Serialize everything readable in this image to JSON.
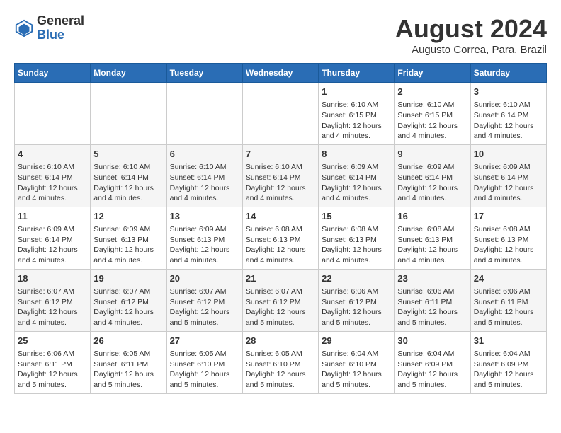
{
  "header": {
    "logo_line1": "General",
    "logo_line2": "Blue",
    "title": "August 2024",
    "subtitle": "Augusto Correa, Para, Brazil"
  },
  "weekdays": [
    "Sunday",
    "Monday",
    "Tuesday",
    "Wednesday",
    "Thursday",
    "Friday",
    "Saturday"
  ],
  "weeks": [
    [
      {
        "day": "",
        "content": ""
      },
      {
        "day": "",
        "content": ""
      },
      {
        "day": "",
        "content": ""
      },
      {
        "day": "",
        "content": ""
      },
      {
        "day": "1",
        "content": "Sunrise: 6:10 AM\nSunset: 6:15 PM\nDaylight: 12 hours\nand 4 minutes."
      },
      {
        "day": "2",
        "content": "Sunrise: 6:10 AM\nSunset: 6:15 PM\nDaylight: 12 hours\nand 4 minutes."
      },
      {
        "day": "3",
        "content": "Sunrise: 6:10 AM\nSunset: 6:14 PM\nDaylight: 12 hours\nand 4 minutes."
      }
    ],
    [
      {
        "day": "4",
        "content": "Sunrise: 6:10 AM\nSunset: 6:14 PM\nDaylight: 12 hours\nand 4 minutes."
      },
      {
        "day": "5",
        "content": "Sunrise: 6:10 AM\nSunset: 6:14 PM\nDaylight: 12 hours\nand 4 minutes."
      },
      {
        "day": "6",
        "content": "Sunrise: 6:10 AM\nSunset: 6:14 PM\nDaylight: 12 hours\nand 4 minutes."
      },
      {
        "day": "7",
        "content": "Sunrise: 6:10 AM\nSunset: 6:14 PM\nDaylight: 12 hours\nand 4 minutes."
      },
      {
        "day": "8",
        "content": "Sunrise: 6:09 AM\nSunset: 6:14 PM\nDaylight: 12 hours\nand 4 minutes."
      },
      {
        "day": "9",
        "content": "Sunrise: 6:09 AM\nSunset: 6:14 PM\nDaylight: 12 hours\nand 4 minutes."
      },
      {
        "day": "10",
        "content": "Sunrise: 6:09 AM\nSunset: 6:14 PM\nDaylight: 12 hours\nand 4 minutes."
      }
    ],
    [
      {
        "day": "11",
        "content": "Sunrise: 6:09 AM\nSunset: 6:14 PM\nDaylight: 12 hours\nand 4 minutes."
      },
      {
        "day": "12",
        "content": "Sunrise: 6:09 AM\nSunset: 6:13 PM\nDaylight: 12 hours\nand 4 minutes."
      },
      {
        "day": "13",
        "content": "Sunrise: 6:09 AM\nSunset: 6:13 PM\nDaylight: 12 hours\nand 4 minutes."
      },
      {
        "day": "14",
        "content": "Sunrise: 6:08 AM\nSunset: 6:13 PM\nDaylight: 12 hours\nand 4 minutes."
      },
      {
        "day": "15",
        "content": "Sunrise: 6:08 AM\nSunset: 6:13 PM\nDaylight: 12 hours\nand 4 minutes."
      },
      {
        "day": "16",
        "content": "Sunrise: 6:08 AM\nSunset: 6:13 PM\nDaylight: 12 hours\nand 4 minutes."
      },
      {
        "day": "17",
        "content": "Sunrise: 6:08 AM\nSunset: 6:13 PM\nDaylight: 12 hours\nand 4 minutes."
      }
    ],
    [
      {
        "day": "18",
        "content": "Sunrise: 6:07 AM\nSunset: 6:12 PM\nDaylight: 12 hours\nand 4 minutes."
      },
      {
        "day": "19",
        "content": "Sunrise: 6:07 AM\nSunset: 6:12 PM\nDaylight: 12 hours\nand 4 minutes."
      },
      {
        "day": "20",
        "content": "Sunrise: 6:07 AM\nSunset: 6:12 PM\nDaylight: 12 hours\nand 5 minutes."
      },
      {
        "day": "21",
        "content": "Sunrise: 6:07 AM\nSunset: 6:12 PM\nDaylight: 12 hours\nand 5 minutes."
      },
      {
        "day": "22",
        "content": "Sunrise: 6:06 AM\nSunset: 6:12 PM\nDaylight: 12 hours\nand 5 minutes."
      },
      {
        "day": "23",
        "content": "Sunrise: 6:06 AM\nSunset: 6:11 PM\nDaylight: 12 hours\nand 5 minutes."
      },
      {
        "day": "24",
        "content": "Sunrise: 6:06 AM\nSunset: 6:11 PM\nDaylight: 12 hours\nand 5 minutes."
      }
    ],
    [
      {
        "day": "25",
        "content": "Sunrise: 6:06 AM\nSunset: 6:11 PM\nDaylight: 12 hours\nand 5 minutes."
      },
      {
        "day": "26",
        "content": "Sunrise: 6:05 AM\nSunset: 6:11 PM\nDaylight: 12 hours\nand 5 minutes."
      },
      {
        "day": "27",
        "content": "Sunrise: 6:05 AM\nSunset: 6:10 PM\nDaylight: 12 hours\nand 5 minutes."
      },
      {
        "day": "28",
        "content": "Sunrise: 6:05 AM\nSunset: 6:10 PM\nDaylight: 12 hours\nand 5 minutes."
      },
      {
        "day": "29",
        "content": "Sunrise: 6:04 AM\nSunset: 6:10 PM\nDaylight: 12 hours\nand 5 minutes."
      },
      {
        "day": "30",
        "content": "Sunrise: 6:04 AM\nSunset: 6:09 PM\nDaylight: 12 hours\nand 5 minutes."
      },
      {
        "day": "31",
        "content": "Sunrise: 6:04 AM\nSunset: 6:09 PM\nDaylight: 12 hours\nand 5 minutes."
      }
    ]
  ]
}
